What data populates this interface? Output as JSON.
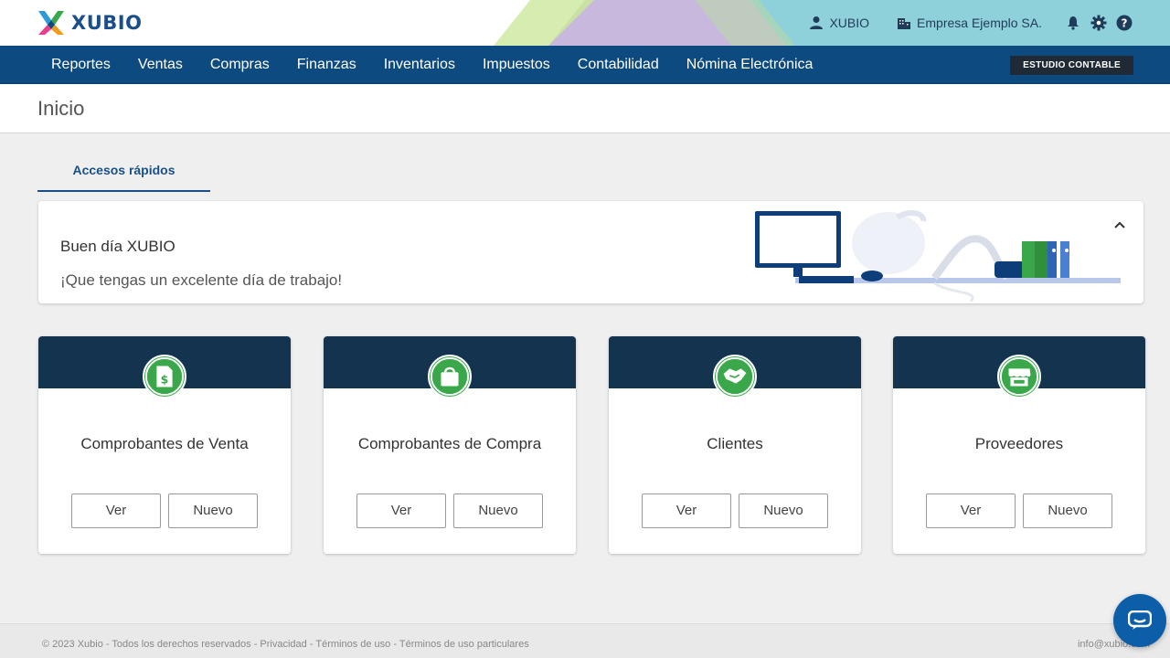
{
  "header": {
    "brand": "XUBIO",
    "user_name": "XUBIO",
    "company_name": "Empresa Ejemplo SA.",
    "icons": [
      "user-icon",
      "building-icon",
      "bell-icon",
      "gear-icon",
      "help-icon"
    ]
  },
  "nav": {
    "items": [
      {
        "label": "Reportes"
      },
      {
        "label": "Ventas"
      },
      {
        "label": "Compras"
      },
      {
        "label": "Finanzas"
      },
      {
        "label": "Inventarios"
      },
      {
        "label": "Impuestos"
      },
      {
        "label": "Contabilidad"
      },
      {
        "label": "Nómina Electrónica"
      }
    ],
    "estudio_label": "ESTUDIO CONTABLE"
  },
  "page": {
    "title": "Inicio",
    "tab_label": "Accesos rápidos"
  },
  "greeting": {
    "title": "Buen día XUBIO",
    "subtitle": "¡Que tengas un excelente día de trabajo!"
  },
  "cards": [
    {
      "title": "Comprobantes de Venta",
      "icon": "invoice-icon",
      "ver": "Ver",
      "nuevo": "Nuevo"
    },
    {
      "title": "Comprobantes de Compra",
      "icon": "shopping-bag-icon",
      "ver": "Ver",
      "nuevo": "Nuevo"
    },
    {
      "title": "Clientes",
      "icon": "handshake-icon",
      "ver": "Ver",
      "nuevo": "Nuevo"
    },
    {
      "title": "Proveedores",
      "icon": "store-icon",
      "ver": "Ver",
      "nuevo": "Nuevo"
    }
  ],
  "footer": {
    "left": "© 2023 Xubio - Todos los derechos reservados - Privacidad - Términos de uso - Términos de uso particulares",
    "right": "info@xubio.com"
  },
  "colors": {
    "navy": "#0d4a80",
    "card_header": "#13334e",
    "accent_green": "#3aa84a",
    "brand_blue": "#1b4f8a"
  }
}
